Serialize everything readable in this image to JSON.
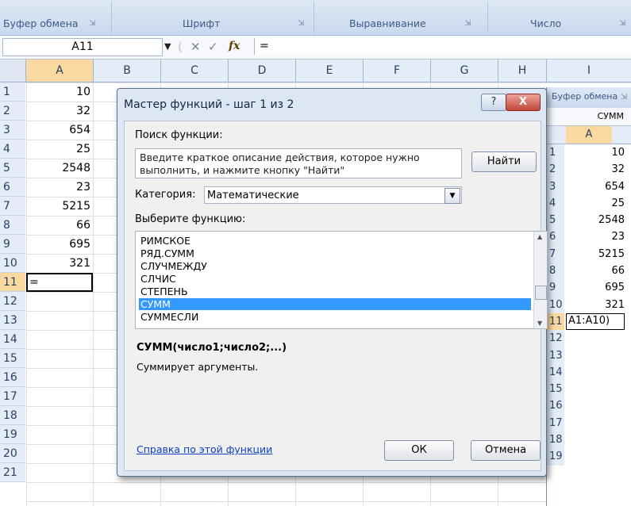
{
  "ribbon": {
    "groups": [
      "Буфер обмена",
      "Шрифт",
      "Выравнивание",
      "Число"
    ]
  },
  "formula_bar": {
    "name_box": "A11",
    "cancel_symbol": "✕",
    "enter_symbol": "✓",
    "fx_symbol": "fx",
    "content": "="
  },
  "sheet": {
    "columns": [
      "A",
      "B",
      "C",
      "D",
      "E",
      "F",
      "G",
      "H",
      "I"
    ],
    "rows": [
      "1",
      "2",
      "3",
      "4",
      "5",
      "6",
      "7",
      "8",
      "9",
      "10",
      "11",
      "12",
      "13",
      "14",
      "15",
      "16",
      "17",
      "18",
      "19",
      "20",
      "21"
    ],
    "values_a": [
      "10",
      "32",
      "654",
      "25",
      "2548",
      "23",
      "5215",
      "66",
      "695",
      "321",
      "="
    ],
    "selected_column": "A",
    "active_row": "11"
  },
  "second_window": {
    "ribbon_label": "Буфер обмена",
    "name_box": "СУММ",
    "column": "A",
    "rows": [
      "1",
      "2",
      "3",
      "4",
      "5",
      "6",
      "7",
      "8",
      "9",
      "10",
      "11",
      "12",
      "13",
      "14",
      "15",
      "16",
      "17",
      "18",
      "19"
    ],
    "values": [
      "10",
      "32",
      "654",
      "25",
      "2548",
      "23",
      "5215",
      "66",
      "695",
      "321",
      "A1:A10)"
    ]
  },
  "dialog": {
    "title": "Мастер функций - шаг 1 из 2",
    "help_symbol": "?",
    "close_symbol": "X",
    "search_label": "Поиск функции:",
    "search_text": "Введите краткое описание действия, которое нужно выполнить, и нажмите кнопку \"Найти\"",
    "find_button": "Найти",
    "category_label": "Категория:",
    "category_value": "Математические",
    "select_label": "Выберите функцию:",
    "functions": [
      "РИМСКОЕ",
      "РЯД.СУММ",
      "СЛУЧМЕЖДУ",
      "СЛЧИС",
      "СТЕПЕНЬ",
      "СУММ",
      "СУММЕСЛИ"
    ],
    "selected_function": "СУММ",
    "signature": "СУММ(число1;число2;...)",
    "description": "Суммирует аргументы.",
    "help_link": "Справка по этой функции",
    "ok_button": "ОК",
    "cancel_button": "Отмена"
  },
  "colors": {
    "selection_blue": "#3399ff",
    "header_selected": "#f9d99f",
    "ribbon": "#c9d9ee",
    "close_red": "#c4463a",
    "link": "#0b3fc0"
  }
}
